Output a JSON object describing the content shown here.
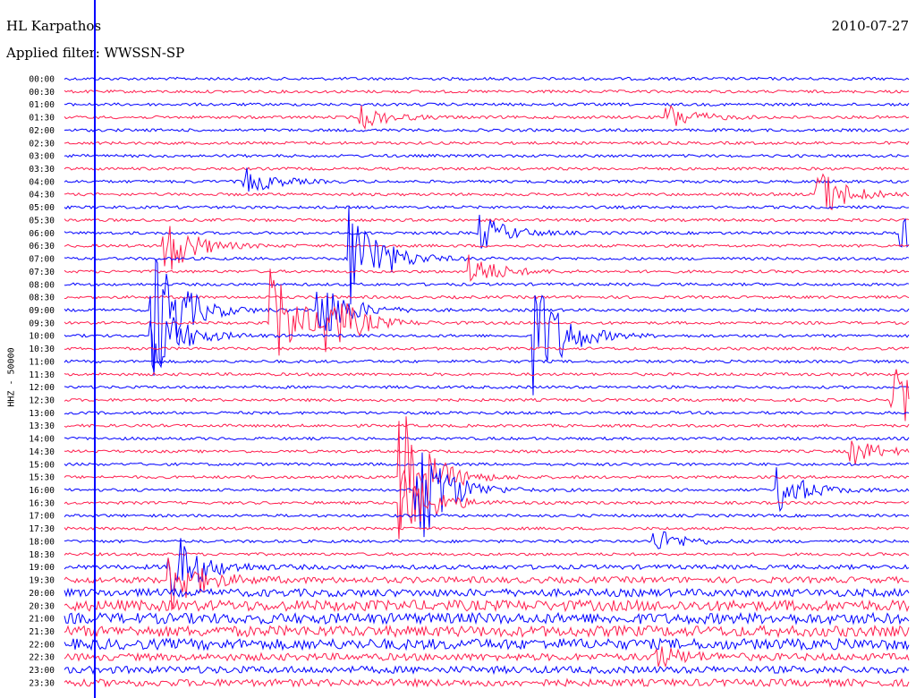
{
  "header": {
    "station": "HL Karpathos",
    "date": "2010-07-27",
    "filter": "Applied filter: WWSSN-SP"
  },
  "chart_data": {
    "type": "line",
    "title": "HL Karpathos",
    "subtitle": "Applied filter: WWSSN-SP",
    "ylabel": "HHZ - 50000",
    "date": "2010-07-27",
    "rows": [
      "00:00",
      "00:30",
      "01:00",
      "01:30",
      "02:00",
      "02:30",
      "03:00",
      "03:30",
      "04:00",
      "04:30",
      "05:00",
      "05:30",
      "06:00",
      "06:30",
      "07:00",
      "07:30",
      "08:00",
      "08:30",
      "09:00",
      "09:30",
      "10:00",
      "10:30",
      "11:00",
      "11:30",
      "12:00",
      "12:30",
      "13:00",
      "13:30",
      "14:00",
      "14:30",
      "15:00",
      "15:30",
      "16:00",
      "16:30",
      "17:00",
      "17:30",
      "18:00",
      "18:30",
      "19:00",
      "19:30",
      "20:00",
      "20:30",
      "21:00",
      "21:30",
      "22:00",
      "22:30",
      "23:00",
      "23:30"
    ],
    "row_minutes": 30,
    "colors": [
      "#0000ff",
      "#ff1f4f"
    ],
    "events": [
      {
        "row": 18,
        "minute": 3.2,
        "amplitude": 80
      },
      {
        "row": 19,
        "minute": 7.4,
        "amplitude": 60
      },
      {
        "row": 20,
        "minute": 3.2,
        "amplitude": 45
      },
      {
        "row": 14,
        "minute": 10.2,
        "amplitude": 70
      },
      {
        "row": 18,
        "minute": 9.0,
        "amplitude": 40
      },
      {
        "row": 19,
        "minute": 9.4,
        "amplitude": 35
      },
      {
        "row": 20,
        "minute": 16.8,
        "amplitude": 65
      },
      {
        "row": 31,
        "minute": 12.0,
        "amplitude": 80
      },
      {
        "row": 32,
        "minute": 12.6,
        "amplitude": 70
      },
      {
        "row": 33,
        "minute": 12.0,
        "amplitude": 50
      },
      {
        "row": 13,
        "minute": 3.6,
        "amplitude": 35
      },
      {
        "row": 38,
        "minute": 3.8,
        "amplitude": 45
      },
      {
        "row": 39,
        "minute": 3.8,
        "amplitude": 35
      },
      {
        "row": 9,
        "minute": 26.8,
        "amplitude": 30
      },
      {
        "row": 29,
        "minute": 28.0,
        "amplitude": 15
      },
      {
        "row": 32,
        "minute": 25.4,
        "amplitude": 25
      },
      {
        "row": 25,
        "minute": 29.5,
        "amplitude": 35
      },
      {
        "row": 12,
        "minute": 29.8,
        "amplitude": 20
      },
      {
        "row": 3,
        "minute": 10.6,
        "amplitude": 12
      },
      {
        "row": 3,
        "minute": 21.5,
        "amplitude": 14
      },
      {
        "row": 8,
        "minute": 6.5,
        "amplitude": 14
      },
      {
        "row": 12,
        "minute": 14.8,
        "amplitude": 20
      },
      {
        "row": 15,
        "minute": 14.5,
        "amplitude": 18
      },
      {
        "row": 36,
        "minute": 21.0,
        "amplitude": 14
      },
      {
        "row": 45,
        "minute": 21.0,
        "amplitude": 12
      }
    ]
  }
}
